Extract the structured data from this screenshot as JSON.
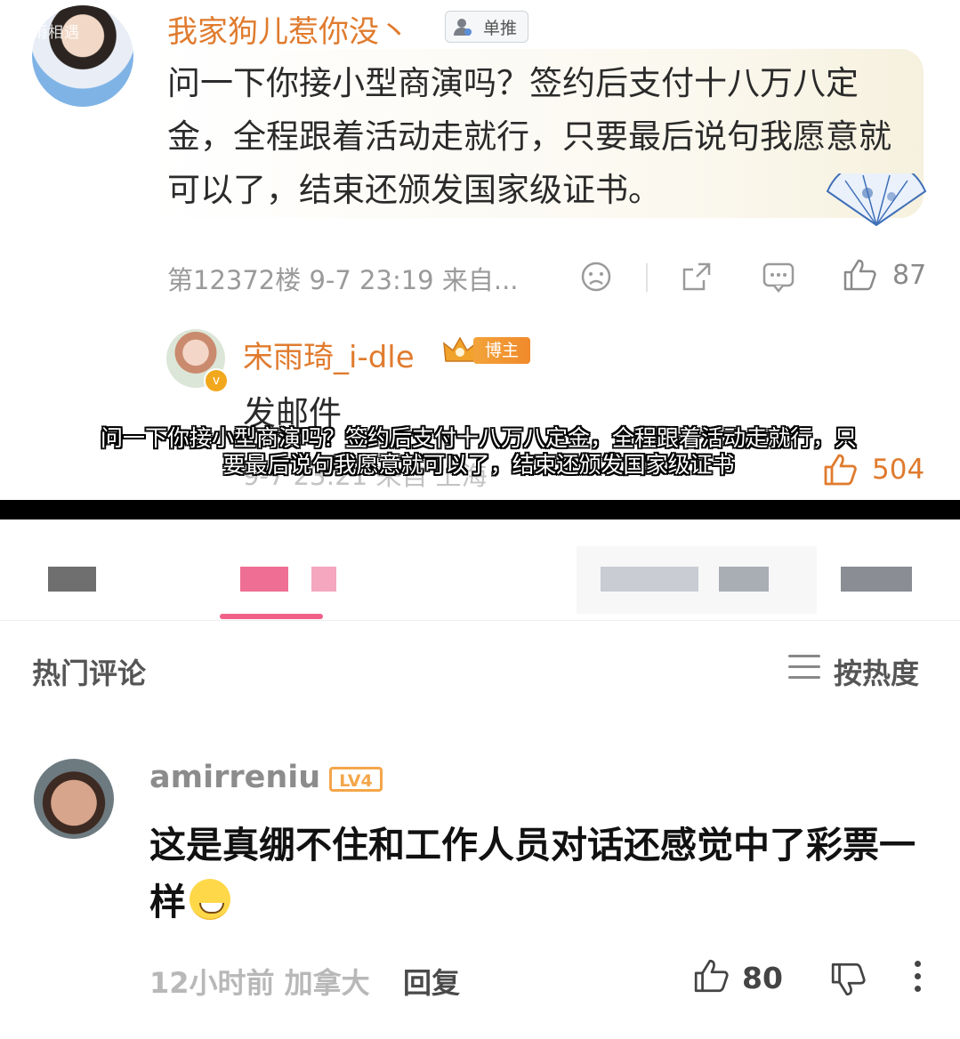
{
  "post_card": {
    "watermark": "宋雨相遇",
    "commenter_name": "我家狗儿惹你没丶",
    "commenter_tag": "单推",
    "comment_text": "问一下你接小型商演吗？签约后支付十八万八定金，全程跟着活动走就行，只要最后说句我愿意就可以了，结束还颁发国家级证书。",
    "meta": "第12372楼  9-7 23:19  来自...",
    "like_count": "87",
    "reply_author": "宋雨琦_i-dle",
    "reply_author_tag": "博主",
    "reply_text": "发邮件",
    "reply_meta": "9-7 23:21 来自 上海",
    "reply_like_count": "504"
  },
  "video_subtitle": "问一下你接小型商演吗？签约后支付十八万八定金，全程跟着活动走就行，只要最后说句我愿意就可以了，结束还颁发国家级证书",
  "section": {
    "title": "热门评论",
    "sort_label": "按热度"
  },
  "hot_comment": {
    "username": "amirreniu",
    "level_badge": "LV4",
    "text": "这是真绷不住和工作人员对话还感觉中了彩票一样",
    "emoji": "sweat-smile-emoji",
    "time_location": "12小时前 加拿大",
    "reply_label": "回复",
    "like_count": "80"
  },
  "colors": {
    "username_orange": "#e07b2e",
    "tab_accent": "#f2608a",
    "level_badge": "#f4a64a"
  }
}
